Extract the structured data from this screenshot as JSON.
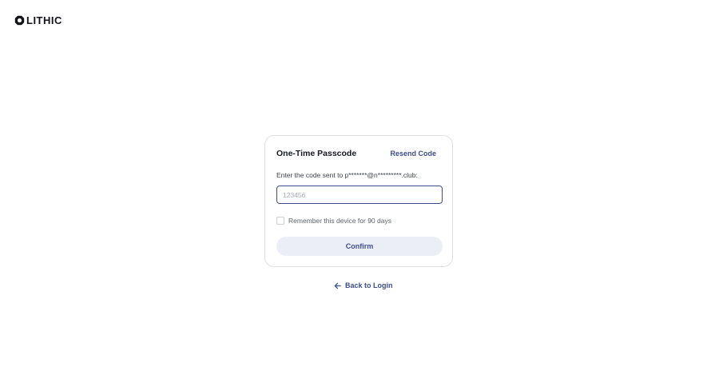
{
  "brand": {
    "logo_text": "LITHIC",
    "logo_icon": "lithic-logo-icon"
  },
  "card": {
    "title": "One-Time Passcode",
    "resend_label": "Resend Code",
    "instruction": "Enter the code sent to p*******@n*********.club:",
    "code_input": {
      "value": "",
      "placeholder": "123456"
    },
    "remember": {
      "label": "Remember this device for 90 days",
      "checked": false
    },
    "confirm_label": "Confirm"
  },
  "footer": {
    "back_label": "Back to Login",
    "back_icon": "arrow-left-icon"
  },
  "colors": {
    "accent": "#3c4d91",
    "button_bg": "#eceef5",
    "border": "#dcdfe5"
  }
}
